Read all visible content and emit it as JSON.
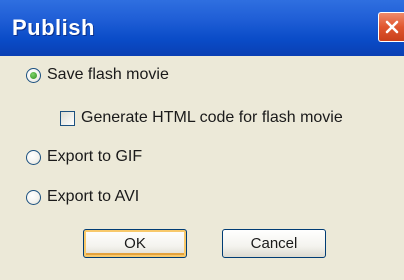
{
  "dialog": {
    "title": "Publish",
    "close_icon": "close-icon",
    "accent_color": "#1f5ed6",
    "close_color": "#e0562f"
  },
  "options": {
    "save_flash": {
      "label": "Save flash movie",
      "checked": true
    },
    "generate_html": {
      "label": "Generate HTML code for flash movie",
      "checked": false
    },
    "export_gif": {
      "label": "Export to GIF",
      "checked": false
    },
    "export_avi": {
      "label": "Export to AVI",
      "checked": false
    }
  },
  "buttons": {
    "ok_label": "OK",
    "cancel_label": "Cancel"
  }
}
